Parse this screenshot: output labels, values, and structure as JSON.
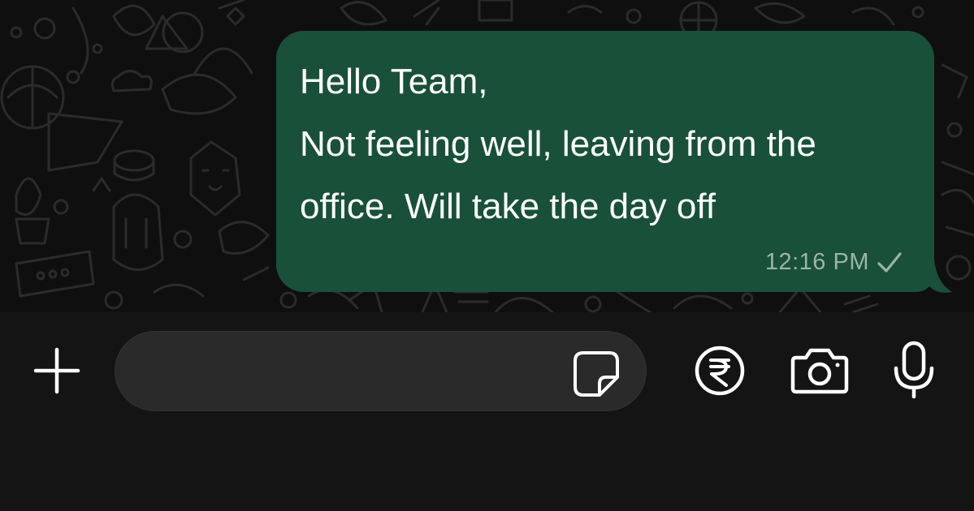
{
  "message": {
    "lines": [
      "Hello Team,",
      "Not feeling well, leaving from the",
      "office. Will take the day off"
    ],
    "time": "12:16 PM",
    "status_icon": "check-icon"
  },
  "composer": {
    "input_value": "",
    "icons": [
      "plus-icon",
      "sticker-icon",
      "rupee-icon",
      "camera-icon",
      "microphone-icon"
    ]
  },
  "colors": {
    "bubble": "#19503a",
    "chat_background": "#0f0f0f",
    "composer_background": "#141414",
    "input_background": "#2a2a2a",
    "timestamp": "#9cb5a8"
  }
}
